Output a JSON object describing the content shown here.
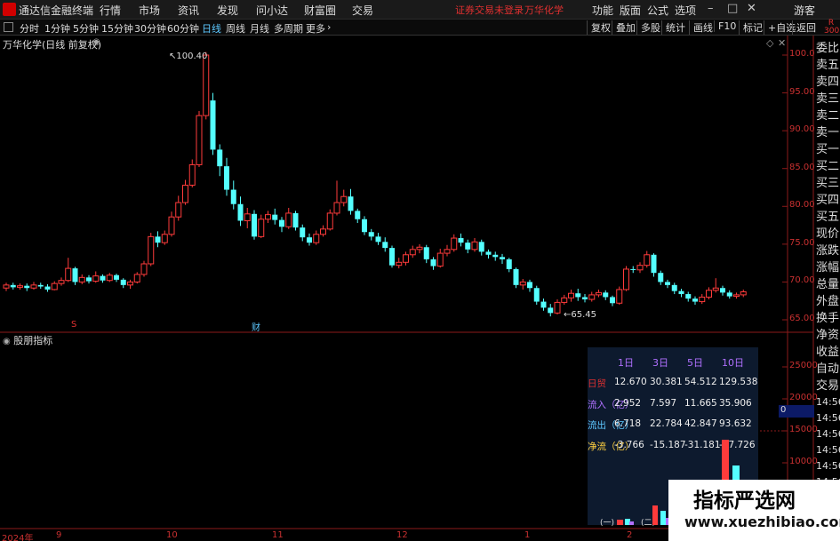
{
  "app": {
    "name": "通达信金融终端",
    "menus": [
      "行情",
      "市场",
      "资讯",
      "发现",
      "问小达",
      "财富圈",
      "交易"
    ],
    "login_warning": "证券交易未登录",
    "stock_name_title": "万华化学",
    "right_menus": [
      "功能",
      "版面",
      "公式",
      "选项"
    ],
    "guest_label": "游客"
  },
  "toolbar": {
    "periods": [
      "分时",
      "1分钟",
      "5分钟",
      "15分钟",
      "30分钟",
      "60分钟",
      "日线",
      "周线",
      "月线",
      "多周期",
      "更多"
    ],
    "active_period": "日线",
    "right_buttons": [
      "复权",
      "叠加",
      "多股",
      "统计",
      "画线",
      "F10",
      "标记",
      "+自选",
      "返回"
    ],
    "r_label": "R",
    "r_num": "300"
  },
  "main_chart": {
    "label": "万华化学(日线 前复权)",
    "high_label": "100.40",
    "low_label": "65.45",
    "event_s": "S",
    "event_cai": "财",
    "y_ticks": [
      "100.0",
      "95.00",
      "90.00",
      "85.00",
      "80.00",
      "75.00",
      "70.00",
      "65.00"
    ]
  },
  "sub_chart": {
    "label": "股朋指标",
    "y_ticks": [
      "25000",
      "20000",
      "15000",
      "10000"
    ],
    "zero_marker": "0"
  },
  "x_axis": {
    "labels": [
      "2024年",
      "9",
      "10",
      "11",
      "12",
      "1",
      "2"
    ]
  },
  "right_panel": {
    "items": [
      "委比",
      "卖五",
      "卖四",
      "卖三",
      "卖二",
      "卖一",
      "买一",
      "买二",
      "买三",
      "买四",
      "买五",
      "现价",
      "涨跌",
      "涨幅",
      "总量",
      "外盘",
      "换手",
      "净资",
      "收益",
      "自动",
      "交易"
    ],
    "times": [
      "14:56",
      "14:56",
      "14:56",
      "14:56",
      "14:56",
      "14:56",
      "14:56",
      "14:56",
      "14:56"
    ]
  },
  "stats": {
    "headers": [
      "1日",
      "3日",
      "5日",
      "10日"
    ],
    "rows": [
      {
        "label": "日贸",
        "values": [
          "12.670",
          "30.381",
          "54.512",
          "129.538"
        ],
        "color": "#e03030"
      },
      {
        "label": "流入（亿）",
        "values": [
          "2.952",
          "7.597",
          "11.665",
          "35.906"
        ],
        "color": "#b070ff"
      },
      {
        "label": "流出（亿）",
        "values": [
          "6.718",
          "22.784",
          "42.847",
          "93.632"
        ],
        "color": "#5ec8ff"
      },
      {
        "label": "净流（亿）",
        "values": [
          "-3.766",
          "-15.187",
          "-31.181",
          "-57.726"
        ],
        "color": "#ffd040"
      }
    ],
    "bottom_labels": [
      "(一)",
      "(二)"
    ]
  },
  "watermark": {
    "title": "指标严选网",
    "url": "www.xuezhibiao.com"
  },
  "chart_data": {
    "type": "candlestick",
    "title": "万华化学(日线 前复权)",
    "ylim": [
      64,
      101.5
    ],
    "candles": [
      [
        69.2,
        69.6,
        69.9,
        68.8
      ],
      [
        69.6,
        69.3,
        69.9,
        69.0
      ],
      [
        69.3,
        69.5,
        69.8,
        69.0
      ],
      [
        69.5,
        69.2,
        69.8,
        68.8
      ],
      [
        69.2,
        69.6,
        70.0,
        69.0
      ],
      [
        69.6,
        69.4,
        69.9,
        69.1
      ],
      [
        69.4,
        69.0,
        69.7,
        68.7
      ],
      [
        69.0,
        69.8,
        70.1,
        68.9
      ],
      [
        69.8,
        70.2,
        70.6,
        69.5
      ],
      [
        70.2,
        71.8,
        73.2,
        70.0
      ],
      [
        71.8,
        70.0,
        72.0,
        69.6
      ],
      [
        70.0,
        70.6,
        71.0,
        69.7
      ],
      [
        70.6,
        70.1,
        70.9,
        69.8
      ],
      [
        70.1,
        70.8,
        71.4,
        69.9
      ],
      [
        70.8,
        70.2,
        71.0,
        69.9
      ],
      [
        70.2,
        70.9,
        71.2,
        70.0
      ],
      [
        70.9,
        70.3,
        71.1,
        70.0
      ],
      [
        70.3,
        69.6,
        70.5,
        69.2
      ],
      [
        69.6,
        70.0,
        70.3,
        69.1
      ],
      [
        70.0,
        71.0,
        71.3,
        69.8
      ],
      [
        71.0,
        72.4,
        72.8,
        70.7
      ],
      [
        72.4,
        76.0,
        76.5,
        72.1
      ],
      [
        76.0,
        75.2,
        76.7,
        74.6
      ],
      [
        75.2,
        76.3,
        76.8,
        74.9
      ],
      [
        76.3,
        78.6,
        79.3,
        76.0
      ],
      [
        78.6,
        80.5,
        81.4,
        78.1
      ],
      [
        80.5,
        82.8,
        83.5,
        80.2
      ],
      [
        82.8,
        85.5,
        86.2,
        82.5
      ],
      [
        85.5,
        92.0,
        92.6,
        85.2
      ],
      [
        92.0,
        100.0,
        100.4,
        91.5
      ],
      [
        94.0,
        87.5,
        95.0,
        86.8
      ],
      [
        87.5,
        85.3,
        88.2,
        84.0
      ],
      [
        85.3,
        82.2,
        86.4,
        81.4
      ],
      [
        82.2,
        80.3,
        83.4,
        79.6
      ],
      [
        80.3,
        78.1,
        81.3,
        77.4
      ],
      [
        78.1,
        79.0,
        79.8,
        77.1
      ],
      [
        79.0,
        76.0,
        79.5,
        75.6
      ],
      [
        76.0,
        78.3,
        78.9,
        75.8
      ],
      [
        78.3,
        78.9,
        79.4,
        77.8
      ],
      [
        78.9,
        78.2,
        79.7,
        77.6
      ],
      [
        78.2,
        77.3,
        78.6,
        76.6
      ],
      [
        77.3,
        79.1,
        79.8,
        77.0
      ],
      [
        79.1,
        77.2,
        79.4,
        76.8
      ],
      [
        77.2,
        75.9,
        77.6,
        75.4
      ],
      [
        75.9,
        75.2,
        76.4,
        74.8
      ],
      [
        75.2,
        76.3,
        76.8,
        74.9
      ],
      [
        76.3,
        77.0,
        77.5,
        76.0
      ],
      [
        77.0,
        79.1,
        79.6,
        76.8
      ],
      [
        79.1,
        80.5,
        83.4,
        78.8
      ],
      [
        80.5,
        81.3,
        82.2,
        80.0
      ],
      [
        81.3,
        79.4,
        82.3,
        78.9
      ],
      [
        79.4,
        78.3,
        79.7,
        77.8
      ],
      [
        78.3,
        76.6,
        78.7,
        76.2
      ],
      [
        76.6,
        76.0,
        77.0,
        75.5
      ],
      [
        76.0,
        75.3,
        76.5,
        74.9
      ],
      [
        75.3,
        74.5,
        75.9,
        74.0
      ],
      [
        74.5,
        72.2,
        74.8,
        71.9
      ],
      [
        72.2,
        72.6,
        73.2,
        71.8
      ],
      [
        72.6,
        73.6,
        74.0,
        72.2
      ],
      [
        73.6,
        74.3,
        74.8,
        73.2
      ],
      [
        74.3,
        74.6,
        75.0,
        73.8
      ],
      [
        74.6,
        73.0,
        74.9,
        72.5
      ],
      [
        73.0,
        72.1,
        73.3,
        71.6
      ],
      [
        72.1,
        73.8,
        74.4,
        71.9
      ],
      [
        73.8,
        74.3,
        74.9,
        73.4
      ],
      [
        74.3,
        75.8,
        76.3,
        74.0
      ],
      [
        75.8,
        75.2,
        76.4,
        74.7
      ],
      [
        75.2,
        74.3,
        75.6,
        73.8
      ],
      [
        74.3,
        75.3,
        75.8,
        74.0
      ],
      [
        75.3,
        74.0,
        75.6,
        73.5
      ],
      [
        74.0,
        73.6,
        74.3,
        73.1
      ],
      [
        73.6,
        73.3,
        74.0,
        72.8
      ],
      [
        73.3,
        73.0,
        73.7,
        72.4
      ],
      [
        73.0,
        71.7,
        73.2,
        71.3
      ],
      [
        71.7,
        69.6,
        71.9,
        69.2
      ],
      [
        69.6,
        70.0,
        70.4,
        69.0
      ],
      [
        70.0,
        69.2,
        70.3,
        68.7
      ],
      [
        69.2,
        67.4,
        69.5,
        67.0
      ],
      [
        67.4,
        66.6,
        67.8,
        66.2
      ],
      [
        66.6,
        65.9,
        67.1,
        65.45
      ],
      [
        65.9,
        67.3,
        67.7,
        65.7
      ],
      [
        67.3,
        67.9,
        68.3,
        67.0
      ],
      [
        67.9,
        68.5,
        69.0,
        67.4
      ],
      [
        68.5,
        68.0,
        69.1,
        67.5
      ],
      [
        68.0,
        67.7,
        68.4,
        67.3
      ],
      [
        67.7,
        68.3,
        68.7,
        67.4
      ],
      [
        68.3,
        68.6,
        69.0,
        68.0
      ],
      [
        68.6,
        68.0,
        68.9,
        67.6
      ],
      [
        68.0,
        67.2,
        68.2,
        66.8
      ],
      [
        67.2,
        69.0,
        69.4,
        67.0
      ],
      [
        69.0,
        71.7,
        72.1,
        68.8
      ],
      [
        71.7,
        71.6,
        72.1,
        71.2
      ],
      [
        71.6,
        72.2,
        72.6,
        71.2
      ],
      [
        72.2,
        73.6,
        74.1,
        71.9
      ],
      [
        73.6,
        71.2,
        73.8,
        70.7
      ],
      [
        71.2,
        70.0,
        71.5,
        69.6
      ],
      [
        70.0,
        69.6,
        70.3,
        69.2
      ],
      [
        69.6,
        68.8,
        69.9,
        68.4
      ],
      [
        68.8,
        68.4,
        69.1,
        68.0
      ],
      [
        68.4,
        67.8,
        68.7,
        67.4
      ],
      [
        67.8,
        67.4,
        68.1,
        67.0
      ],
      [
        67.4,
        68.0,
        68.4,
        67.1
      ],
      [
        68.0,
        68.9,
        69.3,
        67.7
      ],
      [
        68.9,
        69.2,
        70.5,
        68.6
      ],
      [
        69.2,
        68.6,
        69.5,
        68.2
      ],
      [
        68.6,
        68.1,
        68.9,
        67.8
      ],
      [
        68.1,
        68.3,
        68.6,
        67.8
      ],
      [
        68.3,
        68.7,
        69.0,
        68.0
      ]
    ]
  }
}
